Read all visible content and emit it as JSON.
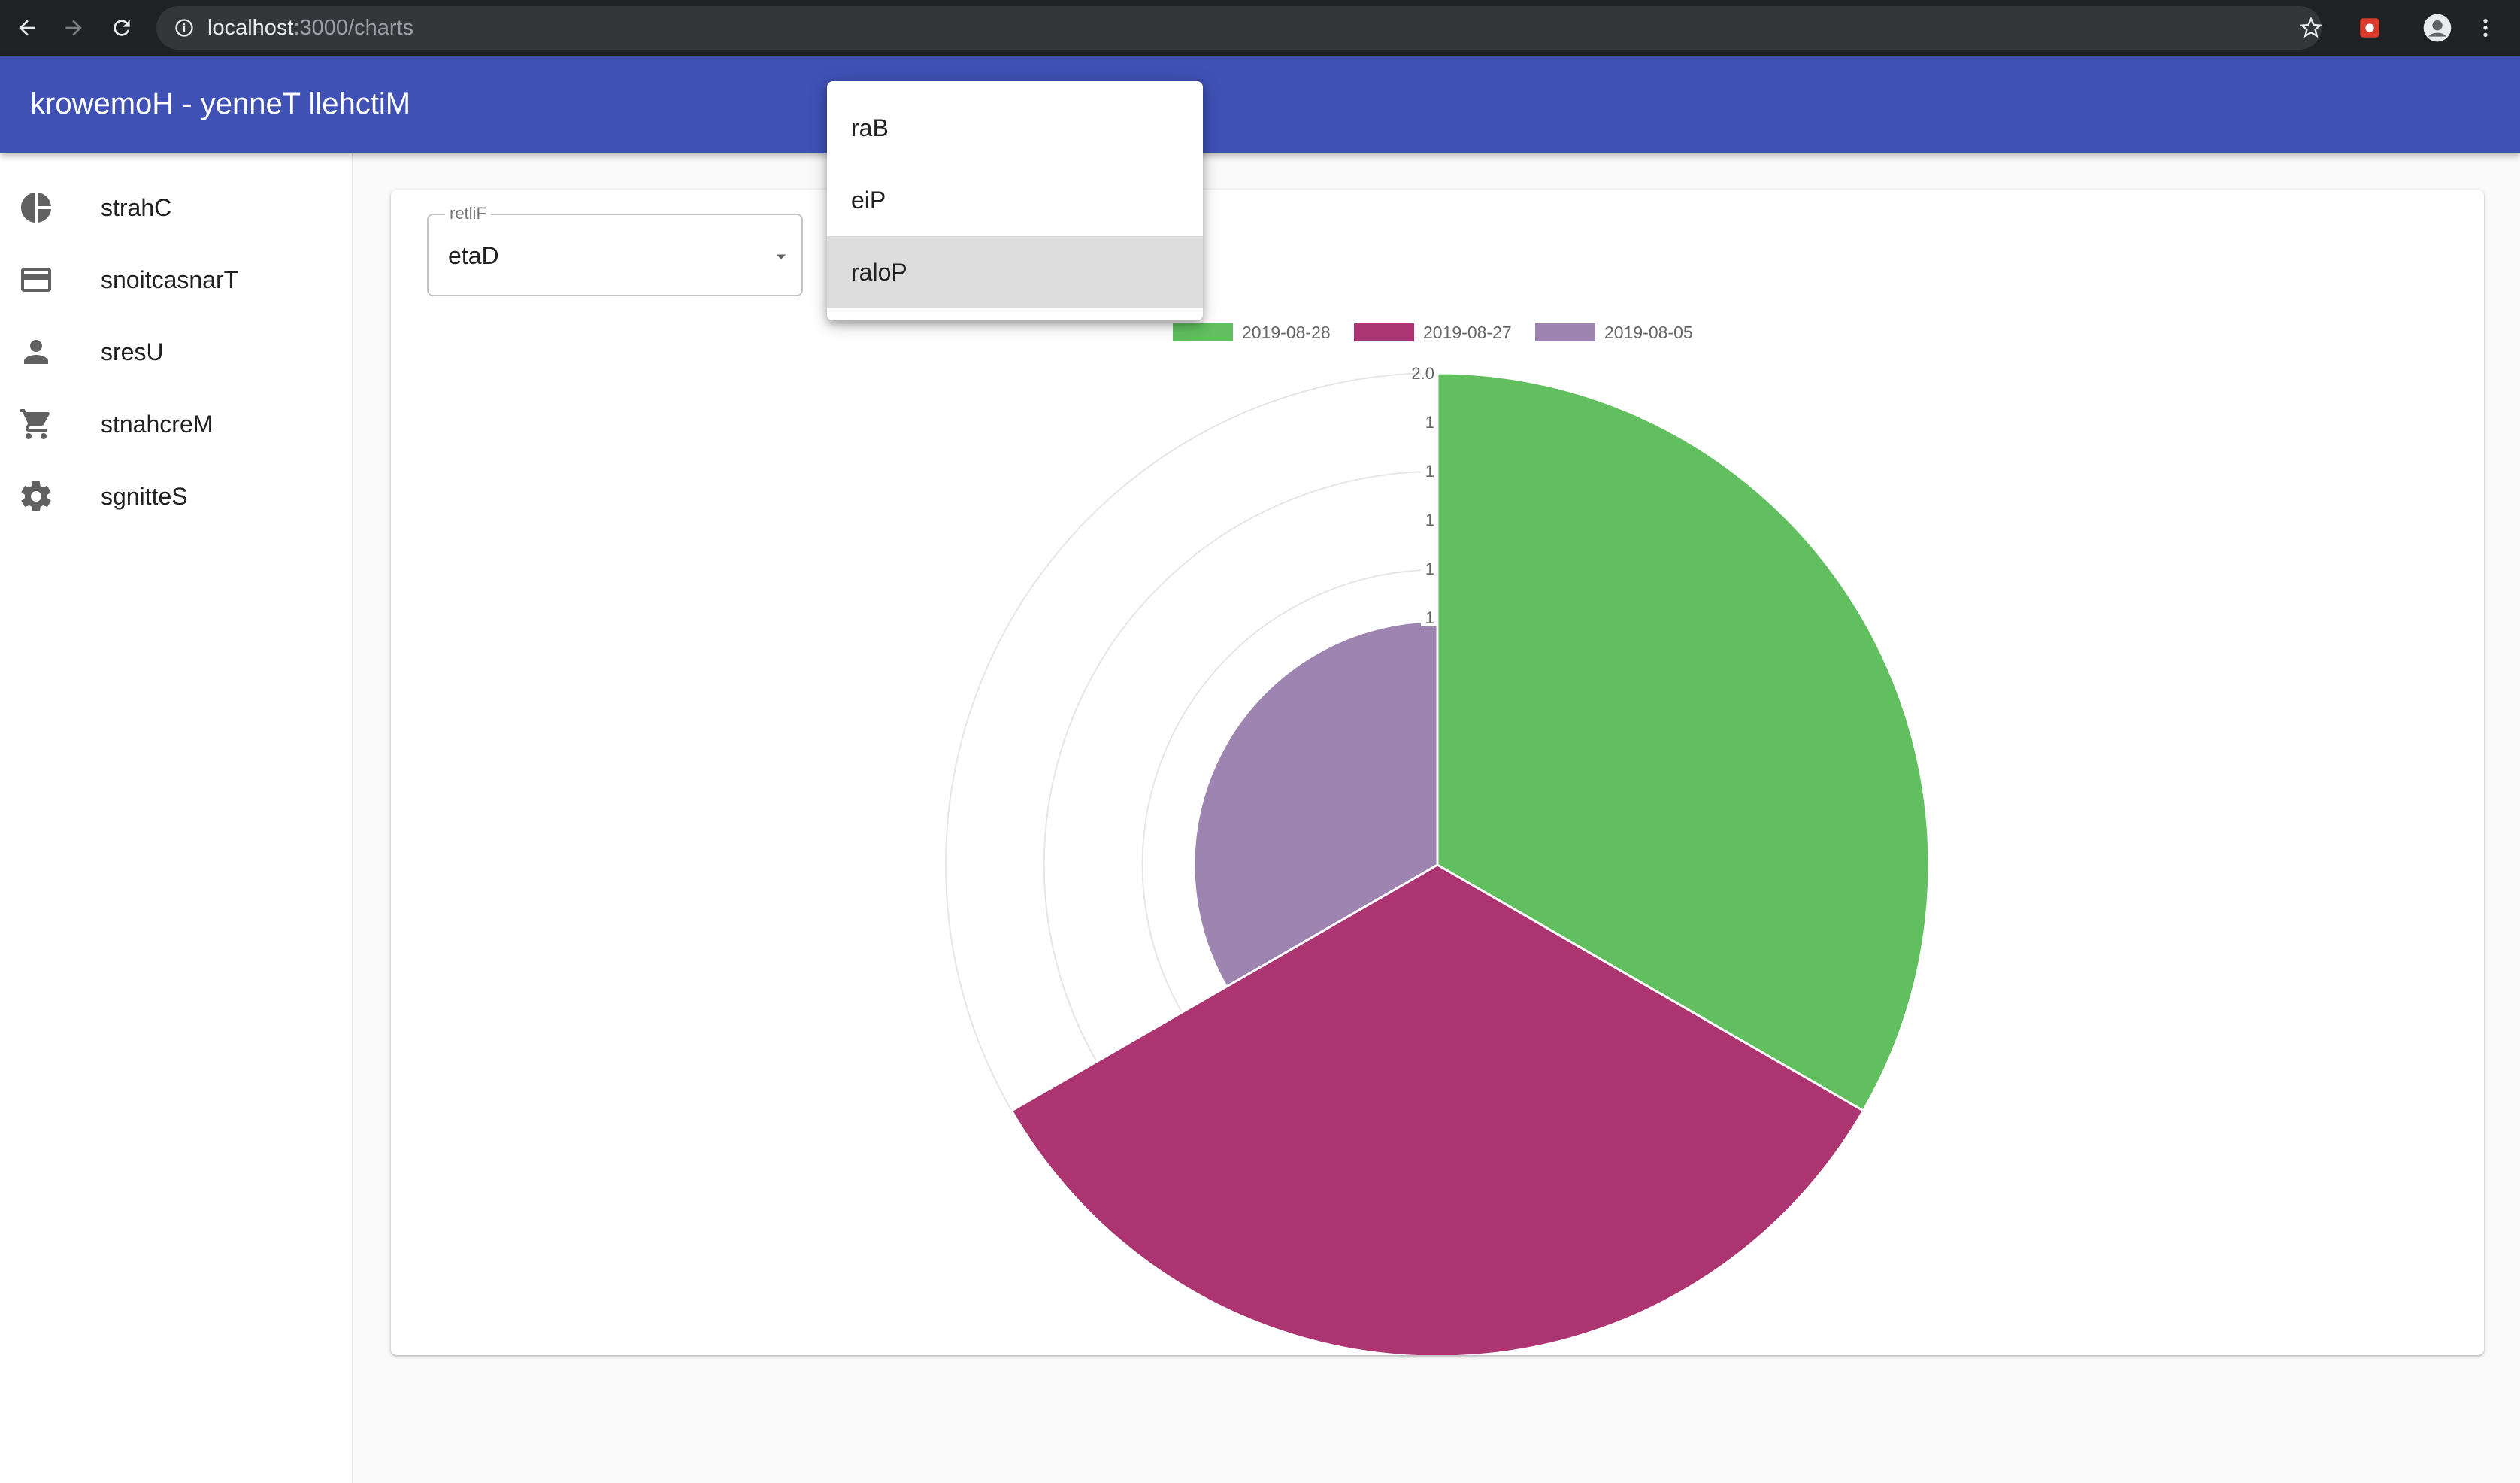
{
  "browser": {
    "url_host": "localhost",
    "url_path": ":3000/charts"
  },
  "app": {
    "title": "krowemoH - yenneT llehctiM"
  },
  "sidebar": {
    "items": [
      {
        "label": "strahC",
        "icon": "pie-chart-icon"
      },
      {
        "label": "snoitcasnarT",
        "icon": "credit-card-icon"
      },
      {
        "label": "sresU",
        "icon": "person-icon"
      },
      {
        "label": "stnahcreM",
        "icon": "shopping-cart-icon"
      },
      {
        "label": "sgnitteS",
        "icon": "gear-icon"
      }
    ]
  },
  "filter": {
    "label": "retliF",
    "value": "etaD"
  },
  "menu": {
    "items": [
      {
        "label": "raB",
        "selected": false
      },
      {
        "label": "eiP",
        "selected": false
      },
      {
        "label": "raloP",
        "selected": true
      }
    ]
  },
  "chart_data": {
    "type": "polarArea",
    "categories": [
      "2019-08-28",
      "2019-08-27",
      "2019-08-05"
    ],
    "values": [
      2,
      2,
      1
    ],
    "colors": [
      "#61bf5f",
      "#ac3470",
      "#9e84b0"
    ],
    "r_max": 2,
    "r_ticks": [
      1.2,
      1.4,
      1.6,
      1.8,
      2.0
    ],
    "r_tick_labels": [
      "1",
      "1",
      "1",
      "1",
      "1",
      "2.0"
    ],
    "legend": "top",
    "grid": true
  }
}
